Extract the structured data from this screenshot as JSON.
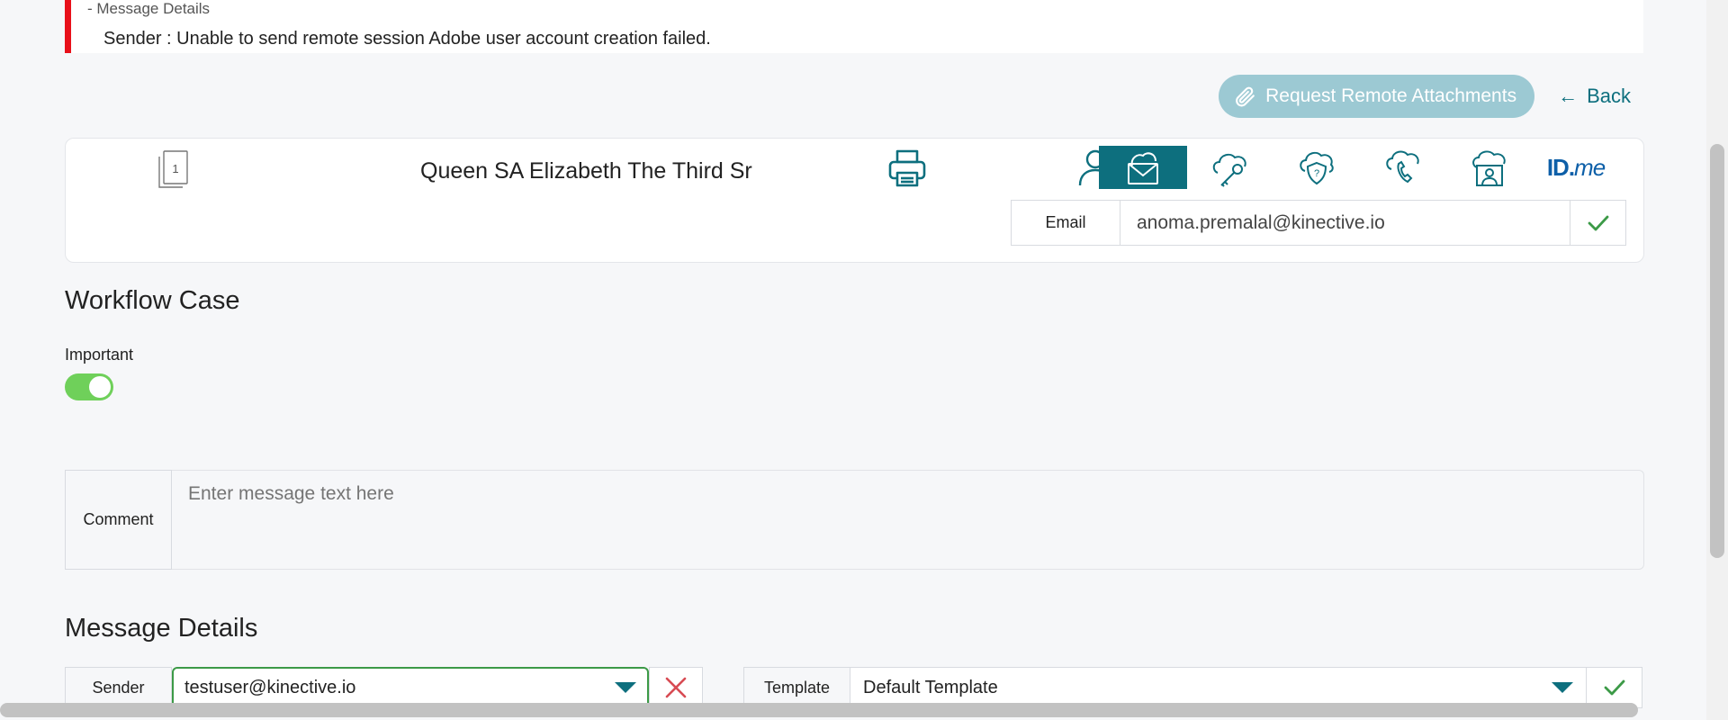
{
  "alert": {
    "title": "- Message Details",
    "message": "Sender :  Unable to send remote session Adobe user account creation failed."
  },
  "actions": {
    "request_remote_label": "Request Remote Attachments",
    "back_label": "Back",
    "back_arrow": "←"
  },
  "customer": {
    "doc_count": "1",
    "name": "Queen SA Elizabeth The Third Sr"
  },
  "channels": {
    "idme_prefix": "ID.",
    "idme_suffix": "me",
    "active": "email"
  },
  "email": {
    "label": "Email",
    "value": "anoma.premalal@kinective.io"
  },
  "workflow": {
    "title": "Workflow Case",
    "important_label": "Important",
    "important_on": true,
    "comment_label": "Comment",
    "comment_placeholder": "Enter message text here"
  },
  "message_details": {
    "title": "Message Details",
    "sender_label": "Sender",
    "sender_value": "testuser@kinective.io",
    "template_label": "Template",
    "template_value": "Default Template"
  },
  "colors": {
    "accent": "#0d6f7e",
    "alert": "#e8101a",
    "success": "#6fd05a",
    "remote_button": "#9cc9d3"
  }
}
